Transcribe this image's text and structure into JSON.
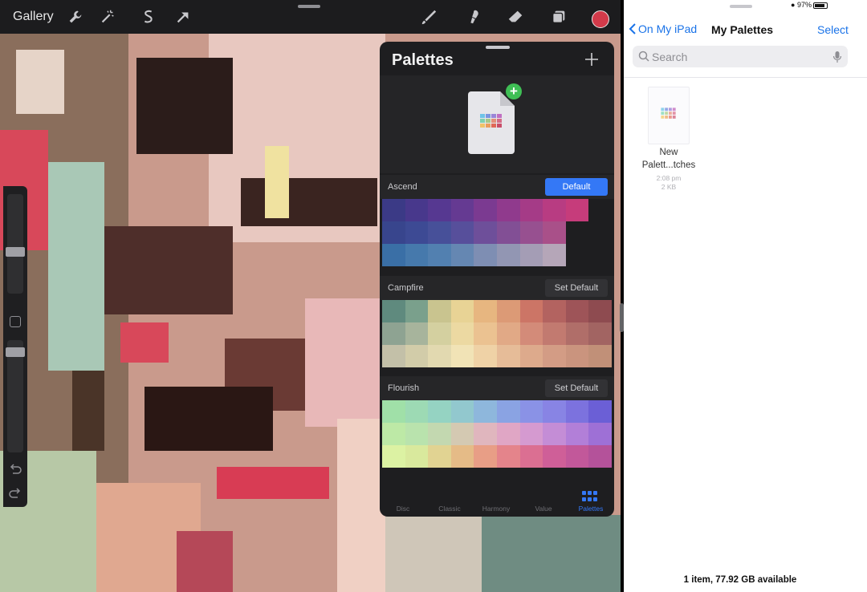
{
  "procreate": {
    "gallery_label": "Gallery",
    "tools_left": [
      "wrench-icon",
      "magic-wand-icon",
      "selection-icon",
      "transform-arrow-icon"
    ],
    "tools_right": [
      "brush-icon",
      "smudge-icon",
      "eraser-icon",
      "layers-icon"
    ],
    "current_color": "#d23a4a"
  },
  "palettes_panel": {
    "title": "Palettes",
    "palettes": [
      {
        "name": "Ascend",
        "button": "Default",
        "is_default": true,
        "rows": [
          [
            "#3b3a86",
            "#48388c",
            "#563891",
            "#653a92",
            "#7b3a91",
            "#903a8d",
            "#a53b87",
            "#b83c82",
            "#c63c7b",
            "#ffffff00"
          ],
          [
            "#38458d",
            "#3d4a94",
            "#475099",
            "#574f9b",
            "#6e4f9a",
            "#824f95",
            "#975090",
            "#a95089",
            "#ffffff00",
            "#ffffff00"
          ],
          [
            "#3a6fa6",
            "#4679ac",
            "#5280b0",
            "#6587b2",
            "#7e8eb3",
            "#9296b3",
            "#a49db5",
            "#b5a6b8",
            "#ffffff00",
            "#ffffff00"
          ]
        ]
      },
      {
        "name": "Campfire",
        "button": "Set Default",
        "is_default": false,
        "rows": [
          [
            "#5f8a7e",
            "#7aa08c",
            "#c9c48f",
            "#e8d395",
            "#e7b680",
            "#dc9a76",
            "#cc7566",
            "#b36360",
            "#9e5458",
            "#8e4b50"
          ],
          [
            "#8ea392",
            "#a7b49c",
            "#d4d0a0",
            "#ecd9a2",
            "#ebc291",
            "#e1a986",
            "#d38b79",
            "#c27a70",
            "#b06e69",
            "#a26462"
          ],
          [
            "#c3c0a8",
            "#d2cca9",
            "#e2d9b0",
            "#f1e3b6",
            "#efd2a6",
            "#e6bc98",
            "#ddaa8c",
            "#d39c85",
            "#ca947e",
            "#c19078"
          ]
        ]
      },
      {
        "name": "Flourish",
        "button": "Set Default",
        "is_default": false,
        "rows": [
          [
            "#a0e0a8",
            "#9ddab4",
            "#95d3c2",
            "#92c8ce",
            "#8eb7dc",
            "#8aa3e3",
            "#8a92e6",
            "#8884e4",
            "#7c72de",
            "#6b5fd6"
          ],
          [
            "#bde9a6",
            "#b9e3ad",
            "#c3d8b0",
            "#d4c9b2",
            "#e0b6be",
            "#e0a6c5",
            "#d59ad0",
            "#c48dd6",
            "#b27fd8",
            "#9e70d6"
          ],
          [
            "#dcf2a3",
            "#d9e99d",
            "#e1d392",
            "#e5bb87",
            "#e89e86",
            "#e4848b",
            "#db6f92",
            "#cf5f98",
            "#c2589a",
            "#b4529a"
          ]
        ]
      }
    ],
    "tabs": [
      "Disc",
      "Classic",
      "Harmony",
      "Value",
      "Palettes"
    ],
    "active_tab": "Palettes",
    "accent": "#3478f6"
  },
  "files": {
    "status": "97%",
    "back_label": "On My iPad",
    "title": "My Palettes",
    "select_label": "Select",
    "search_placeholder": "Search",
    "file": {
      "name_line1": "New",
      "name_line2": "Palett...tches",
      "time": "2:08 pm",
      "size": "2 KB"
    },
    "storage_text": "1 item, 77.92 GB available",
    "accent": "#1a73e8"
  }
}
